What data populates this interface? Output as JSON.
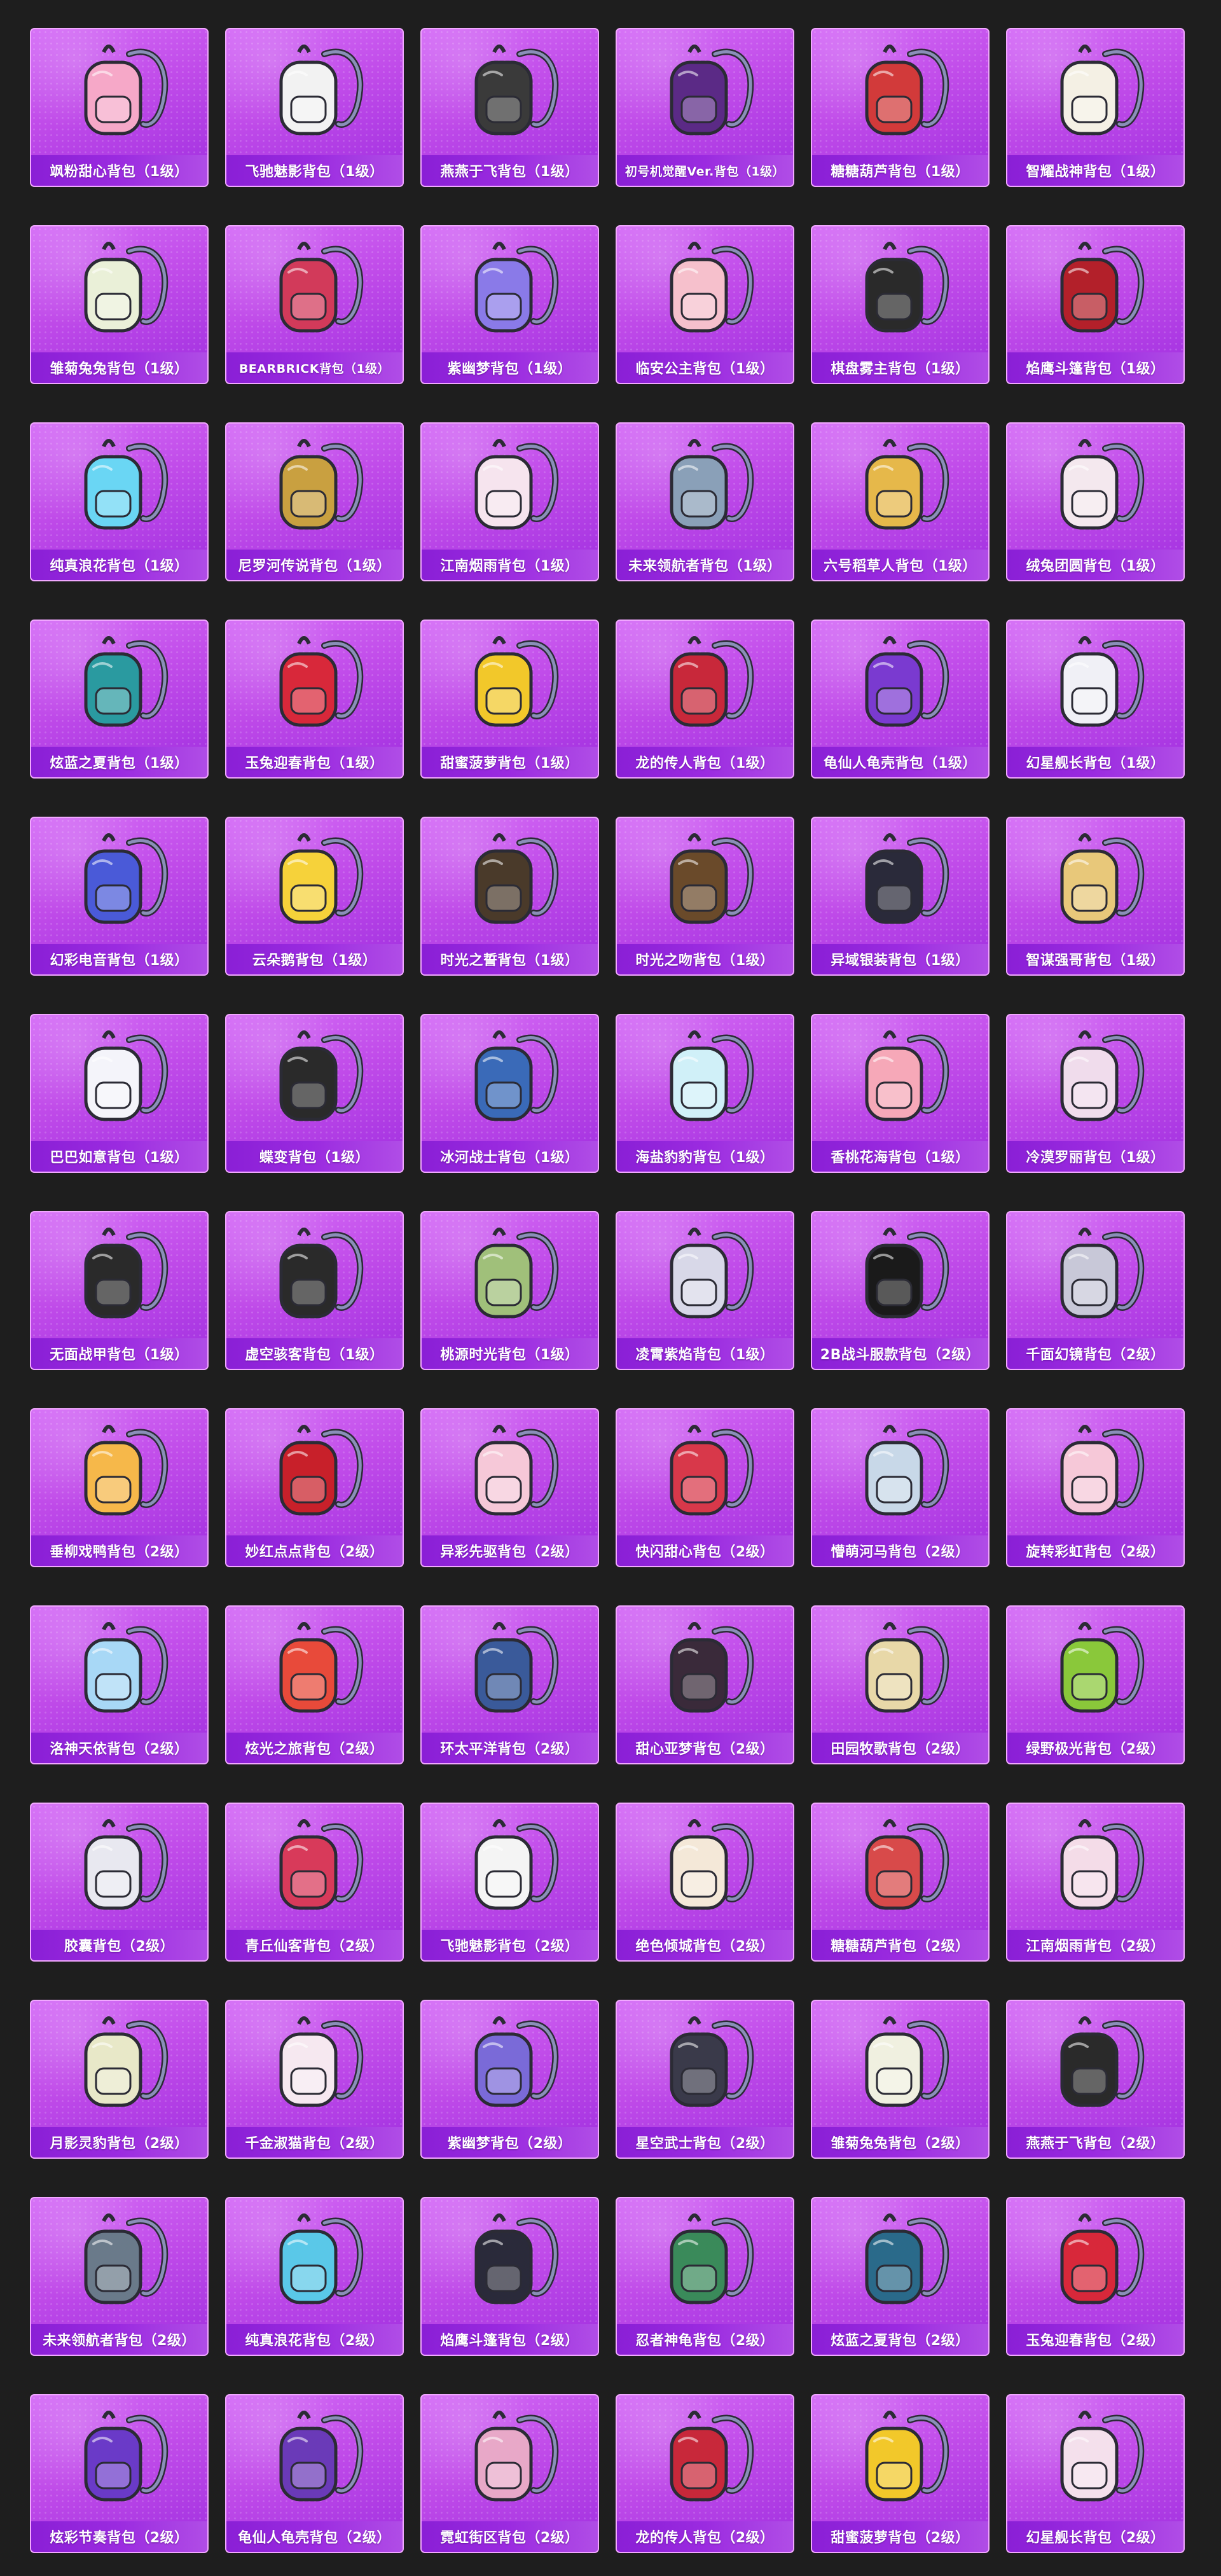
{
  "items": [
    {
      "name": "飒粉甜心背包（1级）",
      "color": "#f6a8c8",
      "icon": "backpack-icon"
    },
    {
      "name": "飞驰魅影背包（1级）",
      "color": "#f2f2f2",
      "icon": "backpack-icon"
    },
    {
      "name": "燕燕于飞背包（1级）",
      "color": "#3a3a3a",
      "icon": "backpack-icon"
    },
    {
      "name": "初号机觉醒Ver.背包（1级）",
      "color": "#5b2a86",
      "icon": "backpack-icon"
    },
    {
      "name": "糖糖葫芦背包（1级）",
      "color": "#d23a3a",
      "icon": "backpack-icon"
    },
    {
      "name": "智耀战神背包（1级）",
      "color": "#f4f0e4",
      "icon": "backpack-icon"
    },
    {
      "name": "雏菊兔兔背包（1级）",
      "color": "#eaf0d8",
      "icon": "backpack-icon"
    },
    {
      "name": "BEARBRICK背包（1级）",
      "color": "#d23a5a",
      "icon": "backpack-icon"
    },
    {
      "name": "紫幽梦背包（1级）",
      "color": "#8a7ae8",
      "icon": "backpack-icon"
    },
    {
      "name": "临安公主背包（1级）",
      "color": "#f6c0cc",
      "icon": "backpack-icon"
    },
    {
      "name": "棋盘雾主背包（1级）",
      "color": "#2a2a2a",
      "icon": "backpack-icon"
    },
    {
      "name": "焰鹰斗篷背包（1级）",
      "color": "#b3202a",
      "icon": "backpack-icon"
    },
    {
      "name": "纯真浪花背包（1级）",
      "color": "#6ad6f4",
      "icon": "backpack-icon"
    },
    {
      "name": "尼罗河传说背包（1级）",
      "color": "#c9a040",
      "icon": "backpack-icon"
    },
    {
      "name": "江南烟雨背包（1级）",
      "color": "#f6e4ee",
      "icon": "backpack-icon"
    },
    {
      "name": "未来领航者背包（1级）",
      "color": "#8aa0b8",
      "icon": "backpack-icon"
    },
    {
      "name": "六号稻草人背包（1级）",
      "color": "#e6b84a",
      "icon": "backpack-icon"
    },
    {
      "name": "绒兔团圆背包（1级）",
      "color": "#f4e8ee",
      "icon": "backpack-icon"
    },
    {
      "name": "炫蓝之夏背包（1级）",
      "color": "#2a9aa0",
      "icon": "backpack-icon"
    },
    {
      "name": "玉兔迎春背包（1级）",
      "color": "#d8283a",
      "icon": "backpack-icon"
    },
    {
      "name": "甜蜜菠萝背包（1级）",
      "color": "#f2c82a",
      "icon": "backpack-icon"
    },
    {
      "name": "龙的传人背包（1级）",
      "color": "#c8283a",
      "icon": "backpack-icon"
    },
    {
      "name": "龟仙人龟壳背包（1级）",
      "color": "#7a3ad0",
      "icon": "backpack-icon"
    },
    {
      "name": "幻星舰长背包（1级）",
      "color": "#f0f0f6",
      "icon": "backpack-icon"
    },
    {
      "name": "幻彩电音背包（1级）",
      "color": "#4a5ad8",
      "icon": "backpack-icon"
    },
    {
      "name": "云朵鹅背包（1级）",
      "color": "#f6d23a",
      "icon": "backpack-icon"
    },
    {
      "name": "时光之誓背包（1级）",
      "color": "#4a3a2a",
      "icon": "backpack-icon"
    },
    {
      "name": "时光之吻背包（1级）",
      "color": "#6a4a2a",
      "icon": "backpack-icon"
    },
    {
      "name": "异域银装背包（1级）",
      "color": "#2a2a3a",
      "icon": "backpack-icon"
    },
    {
      "name": "智谋强哥背包（1级）",
      "color": "#e8c87a",
      "icon": "backpack-icon"
    },
    {
      "name": "巴巴如意背包（1级）",
      "color": "#f4f4fa",
      "icon": "backpack-icon"
    },
    {
      "name": "蝶变背包（1级）",
      "color": "#2a2a2a",
      "icon": "backpack-icon"
    },
    {
      "name": "冰河战士背包（1级）",
      "color": "#3a6ab8",
      "icon": "backpack-icon"
    },
    {
      "name": "海盐豹豹背包（1级）",
      "color": "#d0f0f8",
      "icon": "backpack-icon"
    },
    {
      "name": "香桃花海背包（1级）",
      "color": "#f6a8b8",
      "icon": "backpack-icon"
    },
    {
      "name": "冷漠罗丽背包（1级）",
      "color": "#f0dcec",
      "icon": "backpack-icon"
    },
    {
      "name": "无面战甲背包（1级）",
      "color": "#2a2a2a",
      "icon": "backpack-icon"
    },
    {
      "name": "虚空骇客背包（1级）",
      "color": "#2a2a2a",
      "icon": "backpack-icon"
    },
    {
      "name": "桃源时光背包（1级）",
      "color": "#a0c07a",
      "icon": "backpack-icon"
    },
    {
      "name": "凌霄紫焰背包（1级）",
      "color": "#d8d8e8",
      "icon": "backpack-icon"
    },
    {
      "name": "2B战斗服款背包（2级）",
      "color": "#1a1a1a",
      "icon": "backpack-icon"
    },
    {
      "name": "千面幻镜背包（2级）",
      "color": "#c8c8d8",
      "icon": "backpack-icon"
    },
    {
      "name": "垂柳戏鸭背包（2级）",
      "color": "#f6b84a",
      "icon": "backpack-icon"
    },
    {
      "name": "妙红点点背包（2级）",
      "color": "#c8202a",
      "icon": "backpack-icon"
    },
    {
      "name": "异彩先驱背包（2级）",
      "color": "#f6c8d8",
      "icon": "backpack-icon"
    },
    {
      "name": "快闪甜心背包（2级）",
      "color": "#d8384a",
      "icon": "backpack-icon"
    },
    {
      "name": "懵萌河马背包（2级）",
      "color": "#c8d8e8",
      "icon": "backpack-icon"
    },
    {
      "name": "旋转彩虹背包（2级）",
      "color": "#f6c8d8",
      "icon": "backpack-icon"
    },
    {
      "name": "洛神天依背包（2级）",
      "color": "#a8d8f6",
      "icon": "backpack-icon"
    },
    {
      "name": "炫光之旅背包（2级）",
      "color": "#e84a3a",
      "icon": "backpack-icon"
    },
    {
      "name": "环太平洋背包（2级）",
      "color": "#3a5a9a",
      "icon": "backpack-icon"
    },
    {
      "name": "甜心亚梦背包（2级）",
      "color": "#3a2a3a",
      "icon": "backpack-icon"
    },
    {
      "name": "田园牧歌背包（2级）",
      "color": "#e8d8a8",
      "icon": "backpack-icon"
    },
    {
      "name": "绿野极光背包（2级）",
      "color": "#8ac83a",
      "icon": "backpack-icon"
    },
    {
      "name": "胶囊背包（2级）",
      "color": "#e8e8f0",
      "icon": "backpack-icon"
    },
    {
      "name": "青丘仙客背包（2级）",
      "color": "#d83a5a",
      "icon": "backpack-icon"
    },
    {
      "name": "飞驰魅影背包（2级）",
      "color": "#f4f4f4",
      "icon": "backpack-icon"
    },
    {
      "name": "绝色倾城背包（2级）",
      "color": "#f4e8d8",
      "icon": "backpack-icon"
    },
    {
      "name": "糖糖葫芦背包（2级）",
      "color": "#d84a4a",
      "icon": "backpack-icon"
    },
    {
      "name": "江南烟雨背包（2级）",
      "color": "#f4dce8",
      "icon": "backpack-icon"
    },
    {
      "name": "月影灵豹背包（2级）",
      "color": "#e8e8c8",
      "icon": "backpack-icon"
    },
    {
      "name": "千金淑猫背包（2级）",
      "color": "#f6e8f0",
      "icon": "backpack-icon"
    },
    {
      "name": "紫幽梦背包（2级）",
      "color": "#7a6ad8",
      "icon": "backpack-icon"
    },
    {
      "name": "星空武士背包（2级）",
      "color": "#3a3a4a",
      "icon": "backpack-icon"
    },
    {
      "name": "雏菊兔兔背包（2级）",
      "color": "#f0f0e0",
      "icon": "backpack-icon"
    },
    {
      "name": "燕燕于飞背包（2级）",
      "color": "#2a2a2a",
      "icon": "backpack-icon"
    },
    {
      "name": "未来领航者背包（2级）",
      "color": "#6a7a8a",
      "icon": "backpack-icon"
    },
    {
      "name": "纯真浪花背包（2级）",
      "color": "#5ac8e8",
      "icon": "backpack-icon"
    },
    {
      "name": "焰鹰斗篷背包（2级）",
      "color": "#2a2a3a",
      "icon": "backpack-icon"
    },
    {
      "name": "忍者神龟背包（2级）",
      "color": "#3a8a5a",
      "icon": "backpack-icon"
    },
    {
      "name": "炫蓝之夏背包（2级）",
      "color": "#2a6a8a",
      "icon": "backpack-icon"
    },
    {
      "name": "玉兔迎春背包（2级）",
      "color": "#d8283a",
      "icon": "backpack-icon"
    },
    {
      "name": "炫彩节奏背包（2级）",
      "color": "#6a3ac8",
      "icon": "backpack-icon"
    },
    {
      "name": "龟仙人龟壳背包（2级）",
      "color": "#6a3ab8",
      "icon": "backpack-icon"
    },
    {
      "name": "霓虹街区背包（2级）",
      "color": "#e8a8c8",
      "icon": "backpack-icon"
    },
    {
      "name": "龙的传人背包（2级）",
      "color": "#c8283a",
      "icon": "backpack-icon"
    },
    {
      "name": "甜蜜菠萝背包（2级）",
      "color": "#f2c82a",
      "icon": "backpack-icon"
    },
    {
      "name": "幻星舰长背包（2级）",
      "color": "#f4e0ec",
      "icon": "backpack-icon"
    }
  ]
}
